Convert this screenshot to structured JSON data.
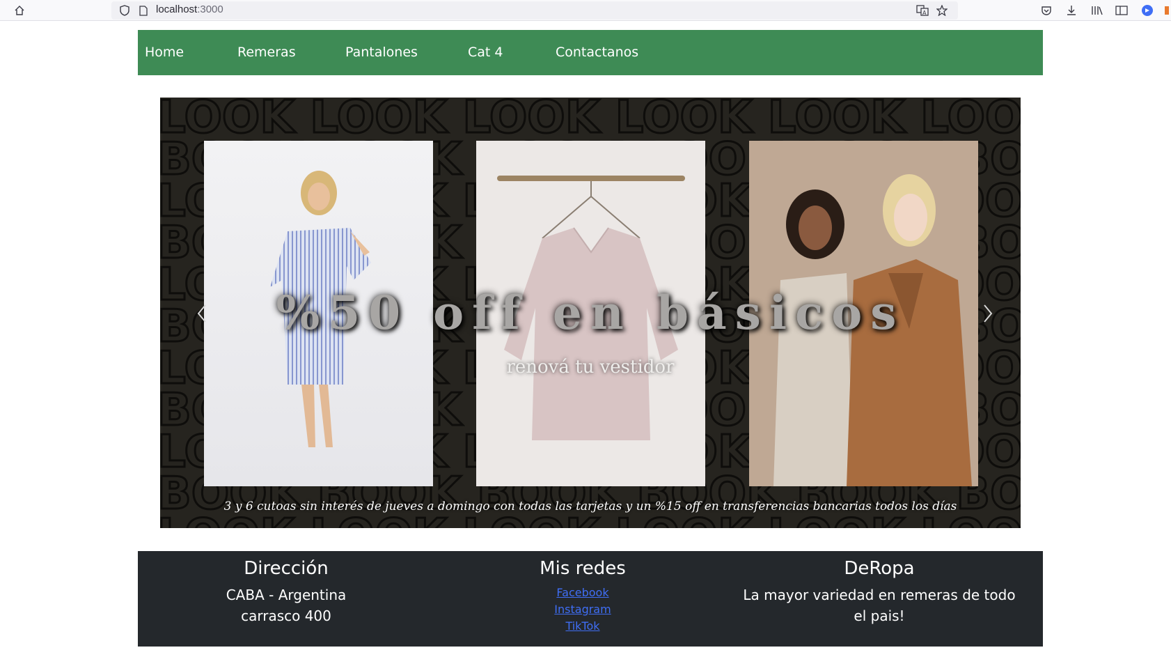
{
  "browser": {
    "url_host": "localhost",
    "url_port": ":3000",
    "icons": [
      "home-icon",
      "shield-icon",
      "page-icon",
      "translate-icon",
      "bookmark-star-icon",
      "pocket-icon",
      "download-icon",
      "library-icon",
      "sidebar-icon",
      "profile-icon"
    ]
  },
  "nav": {
    "items": [
      {
        "label": "Home"
      },
      {
        "label": "Remeras"
      },
      {
        "label": "Pantalones"
      },
      {
        "label": "Cat 4"
      },
      {
        "label": "Contactanos"
      }
    ]
  },
  "carousel": {
    "background_words": [
      "LOOK",
      "BOOK"
    ],
    "title": "%50 off en básicos",
    "subtitle": "renová tu vestidor",
    "promo": "3 y 6 cutoas sin interés de jueves a domingo con todas las tarjetas y un %15 off en transferencias bancarias todos los días",
    "photos": [
      "striped-dress-model",
      "blouse-on-hanger",
      "two-models-coats"
    ],
    "colors": {
      "background": "#26241f",
      "title": "#a8a6a4"
    }
  },
  "footer": {
    "address": {
      "heading": "Dirección",
      "line1": "CABA - Argentina",
      "line2": "carrasco 400"
    },
    "social": {
      "heading": "Mis redes",
      "links": [
        "Facebook",
        "Instagram",
        "TikTok"
      ]
    },
    "brand": {
      "heading": "DeRopa",
      "line1": "La mayor variedad en remeras de todo",
      "line2": "el pais!"
    }
  },
  "colors": {
    "nav_bg": "#3e8b55",
    "footer_bg": "#24282c",
    "link": "#3f6ef5"
  }
}
